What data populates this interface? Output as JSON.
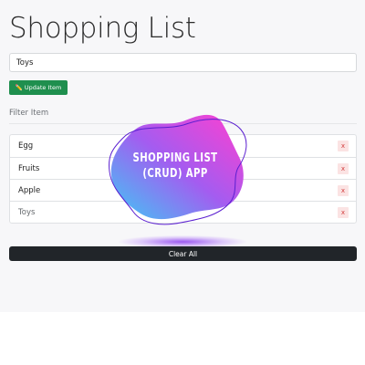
{
  "header": {
    "title": "Shopping List"
  },
  "form": {
    "item_value": "Toys",
    "update_icon": "pencil-icon",
    "update_label": "✏️ Update Item"
  },
  "filter": {
    "label": "Filter Item"
  },
  "items": [
    {
      "name": "Egg",
      "remove": "x"
    },
    {
      "name": "Fruits",
      "remove": "x"
    },
    {
      "name": "Apple",
      "remove": "x"
    },
    {
      "name": "Toys",
      "remove": "x"
    }
  ],
  "clear_label": "Clear All",
  "overlay": {
    "line1": "SHOPPING LIST",
    "line2": "(CRUD) APP"
  },
  "colors": {
    "update_button": "#1f8f4e",
    "clear_button": "#212529",
    "remove_button_bg": "#fbe3e3",
    "remove_button_text": "#d23b3b",
    "badge_gradient_start": "#ff3fd0",
    "badge_gradient_end": "#3ec9f5"
  }
}
